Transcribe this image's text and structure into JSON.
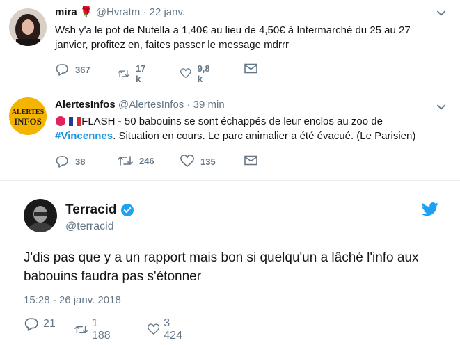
{
  "tweets": [
    {
      "name": "mira",
      "name_emoji": "🌹",
      "handle": "@Hvratm",
      "sep": "·",
      "time": "22 janv.",
      "text": "Wsh y'a le pot de Nutella a 1,40€ au lieu de 4,50€ à Intermarché du 25 au 27 janvier, profitez en, faites passer le message mdrrr",
      "replies": "367",
      "retweets": "17 k",
      "likes": "9,8 k"
    },
    {
      "name": "AlertesInfos",
      "handle": "@AlertesInfos",
      "sep": "·",
      "time": "39 min",
      "avatar_line1": "ALERTES",
      "avatar_line2": "INFOS",
      "text_prefix": "FLASH - 50 babouins se sont échappés de leur enclos au zoo de ",
      "hashtag": "#Vincennes",
      "text_suffix": ". Situation en cours. Le parc animalier a été évacué. (Le Parisien)",
      "replies": "38",
      "retweets": "246",
      "likes": "135"
    }
  ],
  "embedded": {
    "name": "Terracid",
    "handle": "@terracid",
    "text": "J'dis pas que y a un rapport mais bon si quelqu'un a lâché l'info aux babouins faudra pas s'étonner",
    "timestamp": "15:28 - 26 janv. 2018",
    "replies": "21",
    "retweets": "1 188",
    "likes": "3 424"
  },
  "colors": {
    "text": "#14171a",
    "muted": "#657786",
    "link": "#1b95e0",
    "verified": "#1da1f2",
    "alert_red": "#e0245e"
  }
}
